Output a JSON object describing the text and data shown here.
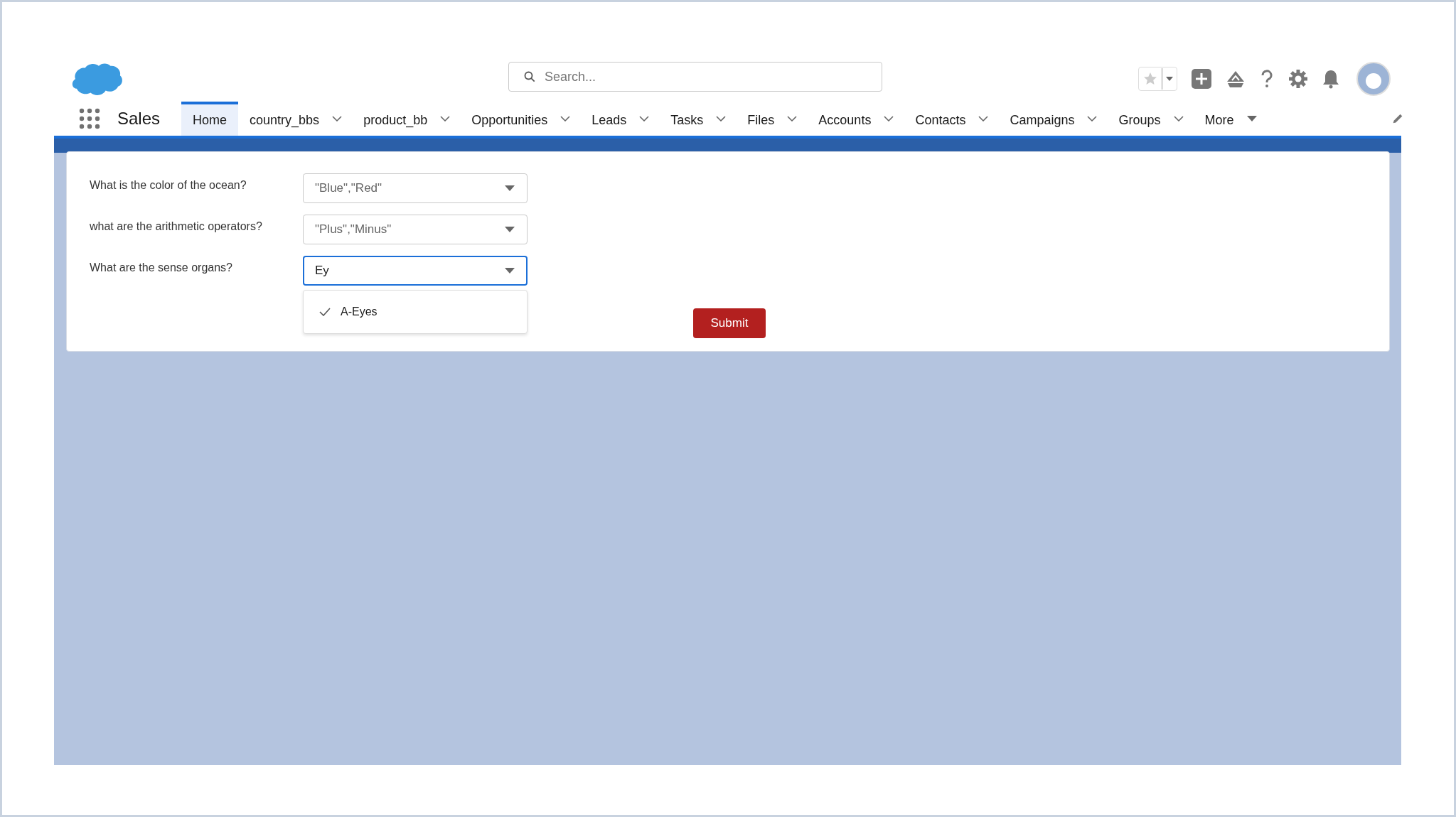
{
  "app": {
    "name": "Sales"
  },
  "search": {
    "placeholder": "Search..."
  },
  "nav": [
    {
      "label": "Home",
      "kind": "plain",
      "selected": true
    },
    {
      "label": "country_bbs",
      "kind": "dropdown",
      "selected": false
    },
    {
      "label": "product_bb",
      "kind": "dropdown",
      "selected": false
    },
    {
      "label": "Opportunities",
      "kind": "dropdown",
      "selected": false
    },
    {
      "label": "Leads",
      "kind": "dropdown",
      "selected": false
    },
    {
      "label": "Tasks",
      "kind": "dropdown",
      "selected": false
    },
    {
      "label": "Files",
      "kind": "dropdown",
      "selected": false
    },
    {
      "label": "Accounts",
      "kind": "dropdown",
      "selected": false
    },
    {
      "label": "Contacts",
      "kind": "dropdown",
      "selected": false
    },
    {
      "label": "Campaigns",
      "kind": "dropdown",
      "selected": false
    },
    {
      "label": "Groups",
      "kind": "dropdown",
      "selected": false
    },
    {
      "label": "More",
      "kind": "more",
      "selected": false
    }
  ],
  "form": {
    "questions": [
      {
        "label": "What is the color of the ocean?",
        "placeholder": "\"Blue\",\"Red\"",
        "focused": false
      },
      {
        "label": "what are the arithmetic operators?",
        "placeholder": "\"Plus\",\"Minus\"",
        "focused": false
      },
      {
        "label": "What are the sense organs?",
        "value": "Ey",
        "focused": true,
        "options": [
          {
            "label": "A-Eyes",
            "checked": true
          }
        ]
      }
    ],
    "submit": "Submit"
  }
}
